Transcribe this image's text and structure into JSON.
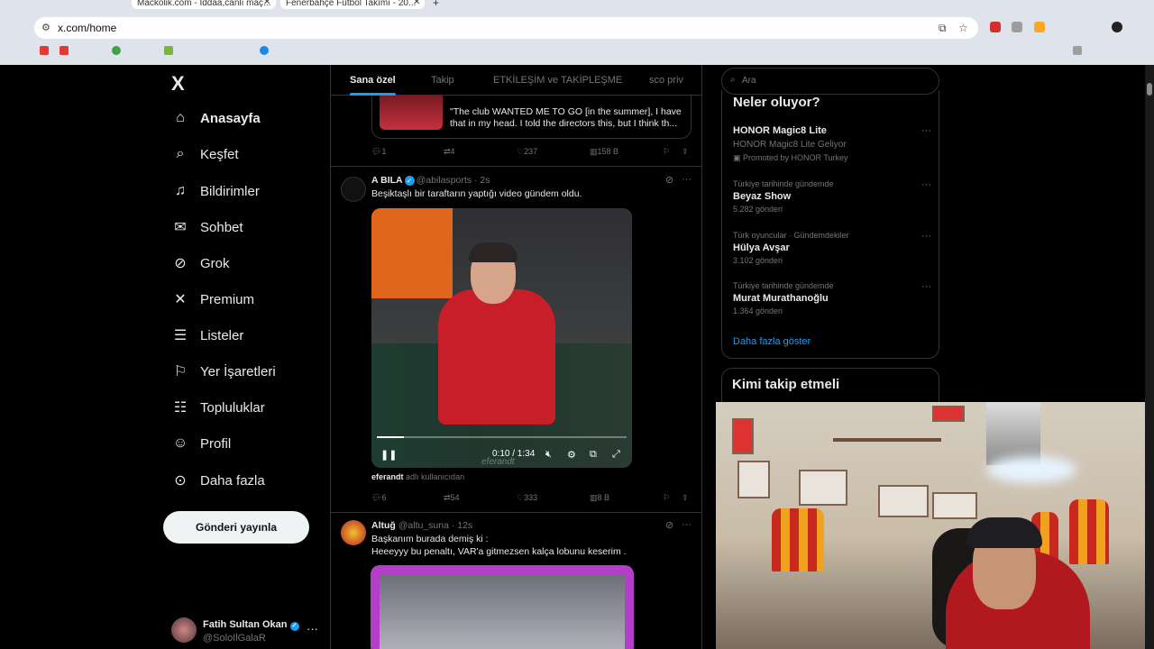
{
  "browser": {
    "tabs": [
      {
        "title": "Mackolik.com - İddaa,canlı maç..."
      },
      {
        "title": "Fenerbahçe Futbol Takımı - 20..."
      }
    ],
    "new_tab": "+",
    "url": "x.com/home",
    "extension_colors": [
      "#d32f2f",
      "#9e9e9e",
      "#f9a825",
      "#e53935"
    ]
  },
  "nav": {
    "logo": "X",
    "items": [
      {
        "label": "Anasayfa",
        "icon": "home-icon",
        "glyph": "⌂",
        "active": true
      },
      {
        "label": "Keşfet",
        "icon": "search-icon",
        "glyph": "⌕"
      },
      {
        "label": "Bildirimler",
        "icon": "bell-icon",
        "glyph": "🔔︎"
      },
      {
        "label": "Sohbet",
        "icon": "mail-icon",
        "glyph": "✉"
      },
      {
        "label": "Grok",
        "icon": "grok-icon",
        "glyph": "⊘"
      },
      {
        "label": "Premium",
        "icon": "x-premium-icon",
        "glyph": "𝕏"
      },
      {
        "label": "Listeler",
        "icon": "list-icon",
        "glyph": "☰"
      },
      {
        "label": "Yer İşaretleri",
        "icon": "bookmark-icon",
        "glyph": "⚐"
      },
      {
        "label": "Topluluklar",
        "icon": "communities-icon",
        "glyph": "☷"
      },
      {
        "label": "Profil",
        "icon": "profile-icon",
        "glyph": "☺"
      },
      {
        "label": "Daha fazla",
        "icon": "more-circle-icon",
        "glyph": "⊙"
      }
    ],
    "post_button": "Gönderi yayınla",
    "account": {
      "name": "Fatih Sultan Okan",
      "handle": "@SoloIlGalaR",
      "more": "···"
    }
  },
  "timeline": {
    "tabs": [
      "Sana özel",
      "Takip",
      "ETKİLEŞİM ve TAKİPLEŞME",
      "sco priv"
    ],
    "active_tab": 0,
    "quoted_text": "\"The club WANTED ME TO GO [in the summer], I have that in my head. I told the directors this, but I think th...",
    "top_actions": {
      "replies": "1",
      "reposts": "4",
      "likes": "237",
      "views": "158 B"
    },
    "posts": [
      {
        "author": "A BILA",
        "handle": "@abilasports",
        "time": "2s",
        "text": "Beşiktaşlı bir taraftarın yaptığı video gündem oldu.",
        "video": {
          "time": "0:10 / 1:34",
          "progress": 0.11,
          "watermark": "eferandt"
        },
        "attribution_user": "eferandt",
        "attribution_suffix": "adlı kullanıcıdan",
        "actions": {
          "replies": "6",
          "reposts": "54",
          "likes": "333",
          "views": "8 B"
        }
      },
      {
        "author": "Altuğ",
        "handle": "@altu_suna",
        "time": "12s",
        "text_line1": "Başkanım burada demiş ki :",
        "text_line2": "Heeeyyy bu penaltı, VAR'a gitmezsen kalça lobunu keserim ."
      }
    ]
  },
  "sidebar": {
    "search_placeholder": "Ara",
    "trends_title": "Neler oluyor?",
    "trends": [
      {
        "context": "HONOR Magic8 Lite",
        "name": "HONOR Magic8 Lite Geliyor",
        "count": "Promoted by HONOR Turkey",
        "promoted": true
      },
      {
        "context": "Türkiye tarihinde gündemde",
        "name": "Beyaz Show",
        "count": "5.282 gönderi"
      },
      {
        "context": "Türk oyuncular · Gündemdekiler",
        "name": "Hülya Avşar",
        "count": "3.102 gönderi"
      },
      {
        "context": "Türkiye tarihinde gündemde",
        "name": "Murat Murathanoğlu",
        "count": "1.364 gönderi"
      }
    ],
    "show_more": "Daha fazla göster",
    "who_to_follow": "Kimi takip etmeli"
  },
  "colors": {
    "accent": "#1d9bf0",
    "background": "#000000",
    "muted": "#71767b"
  }
}
